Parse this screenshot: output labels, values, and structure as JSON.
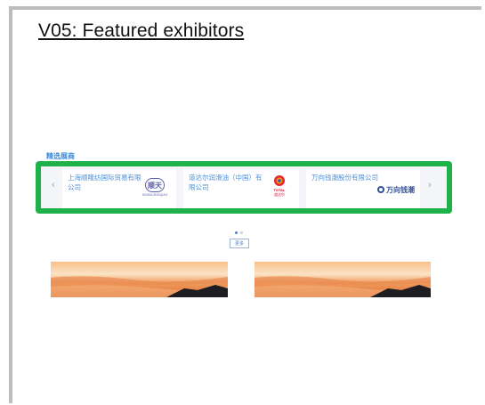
{
  "slide_title": "V05: Featured exhibitors",
  "section_title": "精选展商",
  "carousel": {
    "prev_icon": "‹",
    "next_icon": "›",
    "exhibitors": [
      {
        "name": "上海顺隆纺国际贸易有限公司",
        "logo_text": "顺天",
        "logo_sub": "SHUNLONGQIAO"
      },
      {
        "name": "道达尔润滑油（中国）有限公司",
        "logo_text": "TOTAL",
        "logo_sub": "道达尔"
      },
      {
        "name": "万向钱潮股份有限公司",
        "logo_text": "万向钱潮",
        "logo_sub": ""
      }
    ]
  },
  "more_button": "更多",
  "colors": {
    "highlight": "#1fb14a",
    "section_title": "#3c8dde",
    "exhibitor_name": "#4a90d9"
  }
}
